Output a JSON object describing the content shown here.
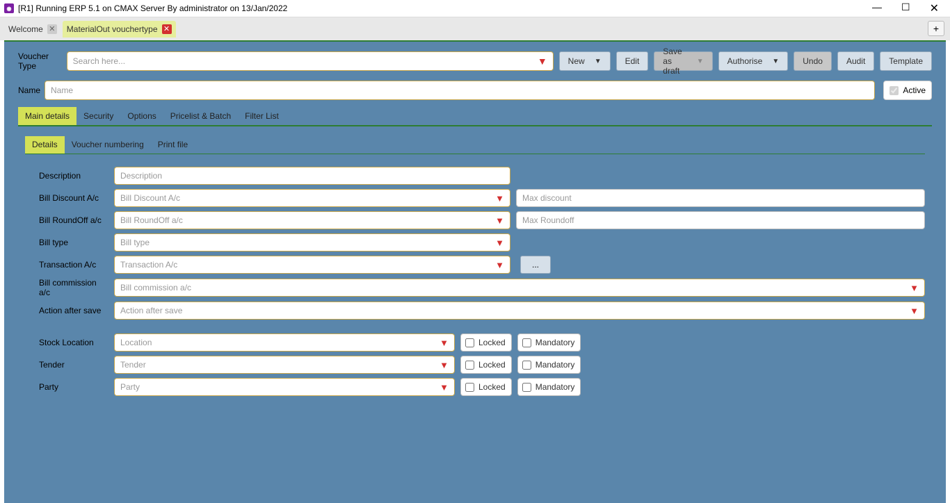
{
  "window": {
    "title": "[R1] Running ERP 5.1 on CMAX Server By administrator on 13/Jan/2022"
  },
  "docTabs": {
    "items": [
      {
        "label": "Welcome",
        "active": false
      },
      {
        "label": "MaterialOut vouchertype",
        "active": true
      }
    ],
    "addLabel": "+"
  },
  "toolbar": {
    "voucherTypeLabel": "Voucher Type",
    "searchPlaceholder": "Search here...",
    "buttons": {
      "new": "New",
      "edit": "Edit",
      "saveAsDraft": "Save as draft",
      "authorise": "Authorise",
      "undo": "Undo",
      "audit": "Audit",
      "template": "Template"
    }
  },
  "nameRow": {
    "label": "Name",
    "placeholder": "Name",
    "activeLabel": "Active"
  },
  "mainTabs": {
    "items": [
      "Main details",
      "Security",
      "Options",
      "Pricelist & Batch",
      "Filter List"
    ],
    "active": 0
  },
  "subTabs": {
    "items": [
      "Details",
      "Voucher numbering",
      "Print file"
    ],
    "active": 0
  },
  "form": {
    "description": {
      "label": "Description",
      "placeholder": "Description"
    },
    "billDiscount": {
      "label": "Bill Discount A/c",
      "placeholder": "Bill Discount A/c",
      "maxPlaceholder": "Max discount"
    },
    "billRoundoff": {
      "label": "Bill RoundOff a/c",
      "placeholder": "Bill RoundOff a/c",
      "maxPlaceholder": "Max Roundoff"
    },
    "billType": {
      "label": "Bill type",
      "placeholder": "Bill type"
    },
    "transactionAc": {
      "label": "Transaction A/c",
      "placeholder": "Transaction A/c",
      "dots": "..."
    },
    "billCommission": {
      "label": "Bill commission a/c",
      "placeholder": "Bill commission a/c"
    },
    "actionAfterSave": {
      "label": "Action after save",
      "placeholder": "Action after save"
    },
    "stockLocation": {
      "label": "Stock Location",
      "placeholder": "Location"
    },
    "tender": {
      "label": "Tender",
      "placeholder": "Tender"
    },
    "party": {
      "label": "Party",
      "placeholder": "Party"
    },
    "locked": "Locked",
    "mandatory": "Mandatory"
  }
}
